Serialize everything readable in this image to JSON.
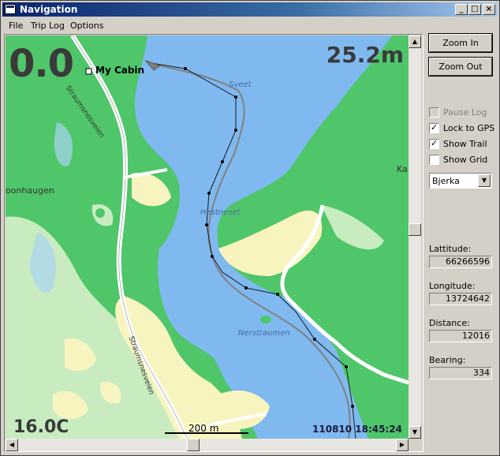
{
  "window": {
    "title": "Navigation"
  },
  "titlebar_buttons": {
    "minimize": "_",
    "maximize": "□",
    "close": "×"
  },
  "menu": {
    "file": "File",
    "trip_log": "Trip Log",
    "options": "Options"
  },
  "map": {
    "speed": "0.0",
    "altitude": "25.2m",
    "temperature": "16.0C",
    "datetime": "110810 18:45:24",
    "scale_label": "200 m",
    "waypoint_label": "My Cabin",
    "place_names": [
      "Sveet",
      "Hestneset",
      "Nerstraumen",
      "Straumsnesveien",
      "Straumsnesveien",
      "oonhaugen",
      "Ka"
    ]
  },
  "controls": {
    "zoom_in": "Zoom In",
    "zoom_out": "Zoom Out",
    "pause_log": {
      "label": "Pause Log",
      "checked": false,
      "enabled": false
    },
    "lock_to_gps": {
      "label": "Lock to GPS",
      "checked": true
    },
    "show_trail": {
      "label": "Show Trail",
      "checked": true
    },
    "show_grid": {
      "label": "Show Grid",
      "checked": false
    },
    "location_select": "Bjerka"
  },
  "readouts": {
    "latitude_label": "Lattitude:",
    "latitude": "66266596",
    "longitude_label": "Longitude:",
    "longitude": "13724642",
    "distance_label": "Distance:",
    "distance": "12016",
    "bearing_label": "Bearing:",
    "bearing": "334"
  },
  "scroll_glyphs": {
    "up": "▲",
    "down": "▼",
    "left": "◀",
    "right": "▶"
  },
  "colors": {
    "water": "#7fb9f0",
    "forest": "#4fc66a",
    "open_land": "#c8ecc0",
    "settlement": "#f8f4c0",
    "road": "#ffffff"
  }
}
